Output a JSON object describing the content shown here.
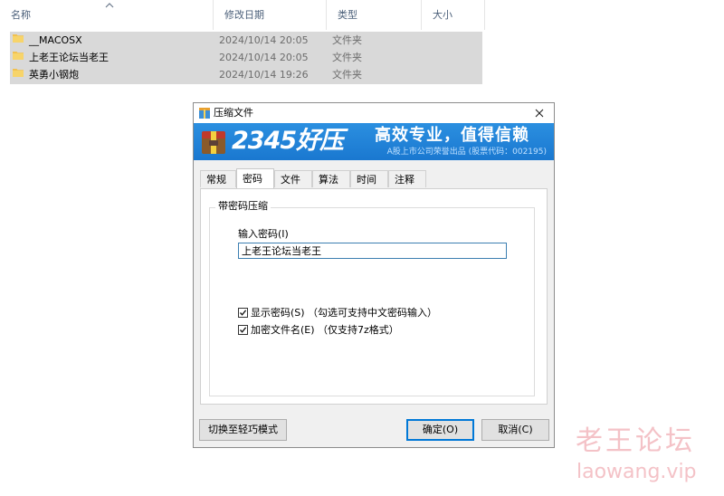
{
  "file_list": {
    "columns": [
      {
        "label": "名称"
      },
      {
        "label": "修改日期"
      },
      {
        "label": "类型"
      },
      {
        "label": "大小"
      }
    ],
    "rows": [
      {
        "name": "__MACOSX",
        "date": "2024/10/14 20:05",
        "type": "文件夹"
      },
      {
        "name": "上老王论坛当老王",
        "date": "2024/10/14 20:05",
        "type": "文件夹"
      },
      {
        "name": "英勇小钢炮",
        "date": "2024/10/14 19:26",
        "type": "文件夹"
      }
    ],
    "sort_icon": "chevron-up-icon"
  },
  "dialog": {
    "title": "压缩文件",
    "close_icon": "close-icon",
    "banner": {
      "logo_text": "2345好压",
      "slogan": "高效专业，值得信赖",
      "sub": "A股上市公司荣誉出品 (股票代码：002195)"
    },
    "tabs": [
      {
        "label": "常规",
        "active": false
      },
      {
        "label": "密码",
        "active": true
      },
      {
        "label": "文件",
        "active": false
      },
      {
        "label": "算法",
        "active": false
      },
      {
        "label": "时间",
        "active": false
      },
      {
        "label": "注释",
        "active": false
      }
    ],
    "group_label": "带密码压缩",
    "password_label": "输入密码(I)",
    "password_value": "上老王论坛当老王",
    "show_password": {
      "label": "显示密码(S) （勾选可支持中文密码输入）",
      "checked": true
    },
    "encrypt_names": {
      "label": "加密文件名(E) （仅支持7z格式）",
      "checked": true
    },
    "buttons": {
      "light_mode": "切换至轻巧模式",
      "ok": "确定(O)",
      "cancel": "取消(C)"
    }
  },
  "watermark": {
    "text": "老王论坛",
    "url": "laowang.vip"
  },
  "colors": {
    "selection": "#d9d9d9",
    "banner_blue": "#1a78d0",
    "focus_blue": "#0078d7",
    "watermark": "#f4c2c7",
    "folder_yellow": "#f2c14e"
  }
}
